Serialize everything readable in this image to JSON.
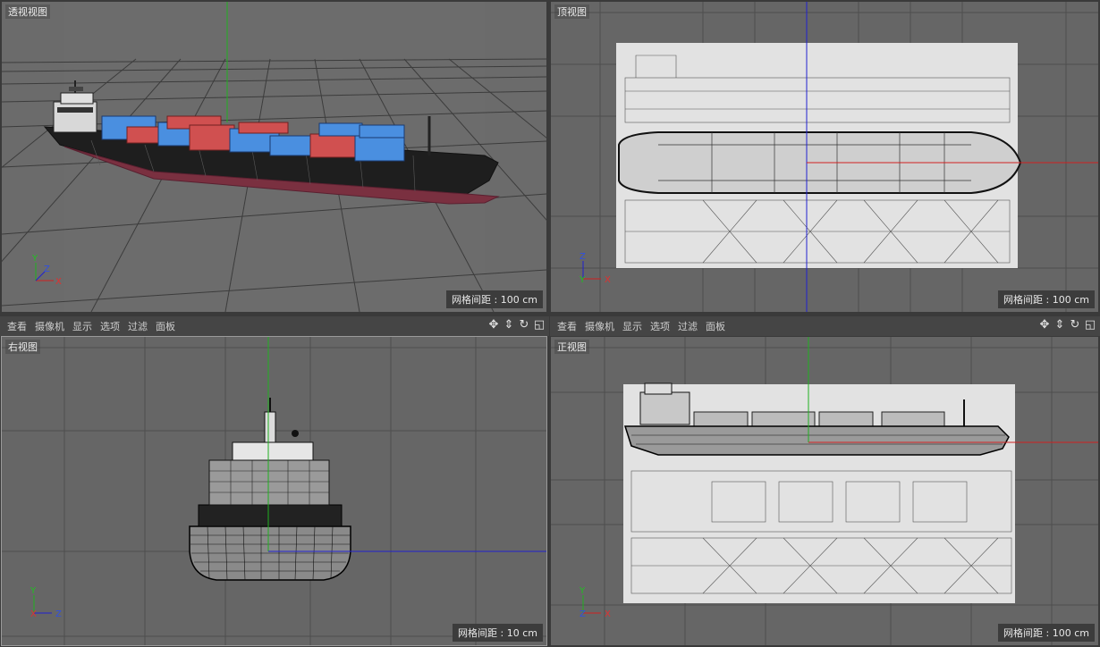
{
  "viewports": {
    "perspective": {
      "label": "透视视图",
      "grid": "网格间距 : 100 cm"
    },
    "top": {
      "label": "顶视图",
      "grid": "网格间距 : 100 cm"
    },
    "right": {
      "label": "右视图",
      "grid": "网格间距 : 10 cm"
    },
    "front": {
      "label": "正视图",
      "grid": "网格间距 : 100 cm"
    }
  },
  "menu": {
    "items": [
      "查看",
      "摄像机",
      "显示",
      "选项",
      "过滤",
      "面板"
    ]
  },
  "axes": {
    "x": "X",
    "y": "Y",
    "z": "Z"
  },
  "nav_icons": [
    "move-view-icon",
    "zoom-view-icon",
    "rotate-view-icon",
    "maximize-view-icon"
  ],
  "colors": {
    "viewport_bg": "#666666",
    "axis_x": "#d02020",
    "axis_y": "#20b020",
    "axis_z": "#2020d0",
    "containers_blue": "#4a8fe0",
    "containers_red": "#d05050",
    "hull": "#2a2a2a"
  }
}
